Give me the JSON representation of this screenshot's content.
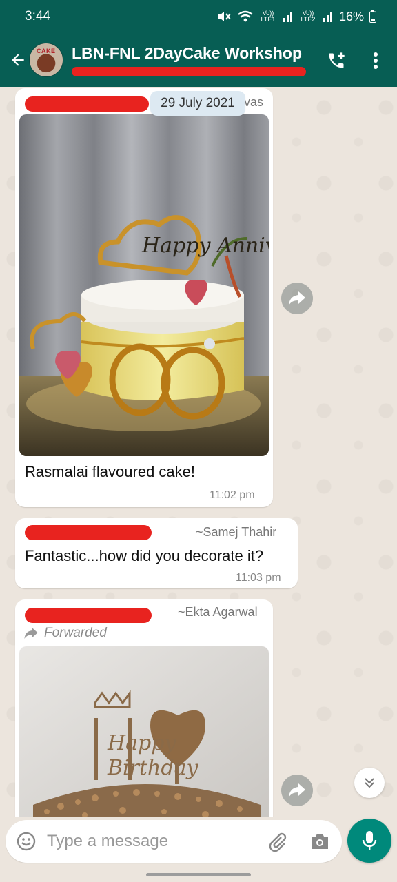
{
  "status_bar": {
    "time": "3:44",
    "sim1_label": "Vo)) LTE1",
    "sim2_label": "Vo)) LTE2",
    "battery": "16%"
  },
  "header": {
    "title": "LBN-FNL 2DayCake Workshop",
    "avatar_text": "CAKE"
  },
  "messages": [
    {
      "sender_suffix": "vas",
      "date_chip": "29 July 2021",
      "caption": "Rasmalai flavoured cake!",
      "time": "11:02 pm",
      "image_text": "Happy Anniversary"
    },
    {
      "sender_name": "~Samej Thahir",
      "text": "Fantastic...how did you decorate it?",
      "time": "11:03 pm"
    },
    {
      "sender_name": "~Ekta Agarwal",
      "forwarded_label": "Forwarded",
      "image_text_1": "Happy",
      "image_text_2": "Birthday"
    }
  ],
  "input": {
    "placeholder": "Type a message"
  },
  "colors": {
    "header_bg": "#075e54",
    "chat_bg": "#ece5dd",
    "mic_button": "#00897b",
    "redaction": "#e8231f",
    "date_chip_bg": "#dde9f2"
  },
  "icons": [
    "back-arrow-icon",
    "add-call-icon",
    "more-vert-icon",
    "forward-icon",
    "share-icon",
    "double-chevron-down-icon",
    "emoji-icon",
    "paperclip-icon",
    "camera-icon",
    "mic-icon"
  ]
}
